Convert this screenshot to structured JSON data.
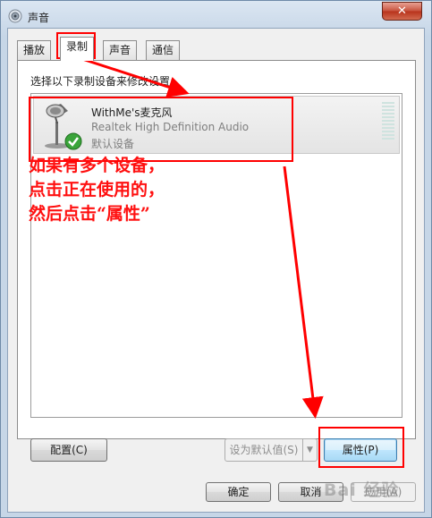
{
  "window": {
    "title": "声音",
    "close_glyph": "✕"
  },
  "tabs": [
    {
      "label": "播放",
      "active": false
    },
    {
      "label": "录制",
      "active": true
    },
    {
      "label": "声音",
      "active": false
    },
    {
      "label": "通信",
      "active": false
    }
  ],
  "panel": {
    "instruction": "选择以下录制设备来修改设置:",
    "devices": [
      {
        "name": "WithMe's麦克风",
        "driver": "Realtek High Definition Audio",
        "status": "默认设备",
        "icon": "microphone-icon",
        "badge": "check-icon"
      }
    ]
  },
  "annotation": {
    "lines": [
      "如果有多个设备，",
      "点击正在使用的，",
      "然后点击“属性”"
    ],
    "color": "#ff0000"
  },
  "buttons": {
    "configure": "配置(C)",
    "set_default": "设为默认值(S)",
    "properties": "属性(P)",
    "ok": "确定",
    "cancel": "取消",
    "apply": "应用(A)"
  },
  "watermark": "Bai 经验"
}
